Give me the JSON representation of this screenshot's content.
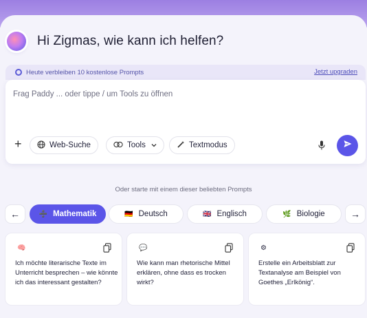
{
  "greeting": "Hi Zigmas, wie kann ich helfen?",
  "prompt_bar": {
    "remaining_text": "Heute verbleiben 10 kostenlose Prompts",
    "upgrade_label": "Jetzt upgraden"
  },
  "input": {
    "placeholder": "Frag Paddy ... oder tippe / um Tools zu öffnen",
    "add_label": "+",
    "web_search_label": "Web-Suche",
    "tools_label": "Tools",
    "text_mode_label": "Textmodus"
  },
  "suggestions": {
    "title": "Oder starte mit einem dieser beliebten Prompts",
    "prev_label": "←",
    "next_label": "→",
    "tabs": [
      {
        "label": "Mathematik",
        "icon": "➗",
        "active": true
      },
      {
        "label": "Deutsch",
        "icon": "🇩🇪",
        "active": false
      },
      {
        "label": "Englisch",
        "icon": "🇬🇧",
        "active": false
      },
      {
        "label": "Biologie",
        "icon": "🌿",
        "active": false
      }
    ],
    "cards": [
      {
        "icon": "🧠",
        "text": "Ich möchte literarische Texte im Unterricht besprechen – wie könnte ich das interessant gestalten?"
      },
      {
        "icon": "💬",
        "text": "Wie kann man rhetorische Mittel erklären, ohne dass es trocken wirkt?"
      },
      {
        "icon": "⚙",
        "text": "Erstelle ein Arbeitsblatt zur Textanalyse am Beispiel von Goethes „Erlkönig“."
      }
    ]
  },
  "colors": {
    "accent": "#5b55e8",
    "header_purple": "#a98ee6"
  }
}
